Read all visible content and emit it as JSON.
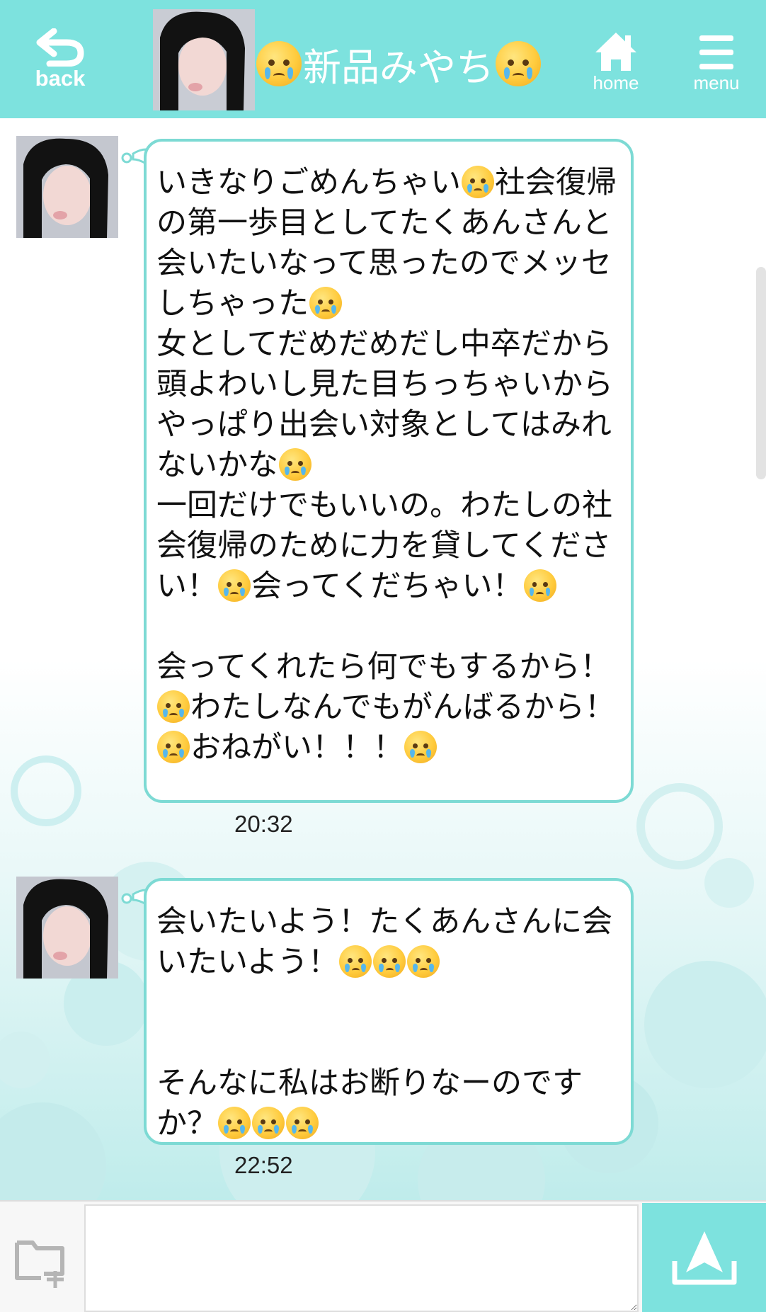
{
  "header": {
    "back_label": "back",
    "home_label": "home",
    "menu_label": "menu",
    "title": "新品みやち"
  },
  "messages": [
    {
      "segments": [
        {
          "t": "いきなりごめんちゃい"
        },
        {
          "e": "crying-face"
        },
        {
          "t": "社会復帰の第一歩目としてたくあんさんと会いたいなって思ったのでメッセしちゃった"
        },
        {
          "e": "crying-face"
        },
        {
          "t": "\n女としてだめだめだし中卒だから頭よわいし見た目ちっちゃいからやっぱり出会い対象としてはみれないかな"
        },
        {
          "e": "crying-face"
        },
        {
          "t": "\n一回だけでもいいの。わたしの社会復帰のために力を貸してください！"
        },
        {
          "e": "crying-face"
        },
        {
          "t": "会ってくだちゃい！"
        },
        {
          "e": "crying-face"
        },
        {
          "t": "\n\n会ってくれたら何でもするから！"
        },
        {
          "e": "crying-face"
        },
        {
          "t": "わたしなんでもがんばるから！"
        },
        {
          "e": "crying-face"
        },
        {
          "t": "おねがい！！！"
        },
        {
          "e": "crying-face"
        }
      ],
      "time": "20:32"
    },
    {
      "segments": [
        {
          "t": "会いたいよう！たくあんさんに会いたいよう！"
        },
        {
          "e": "crying-face"
        },
        {
          "e": "crying-face"
        },
        {
          "e": "crying-face"
        },
        {
          "t": "\n\n\nそんなに私はお断りなーのですか？"
        },
        {
          "e": "crying-face"
        },
        {
          "e": "crying-face"
        },
        {
          "e": "crying-face"
        }
      ],
      "time": "22:52"
    }
  ],
  "compose": {
    "placeholder": ""
  },
  "colors": {
    "accent": "#7de2de",
    "bubble_border": "#7ddad4",
    "emoji_face": "#ffcb3d",
    "emoji_tear": "#56b7ec"
  }
}
